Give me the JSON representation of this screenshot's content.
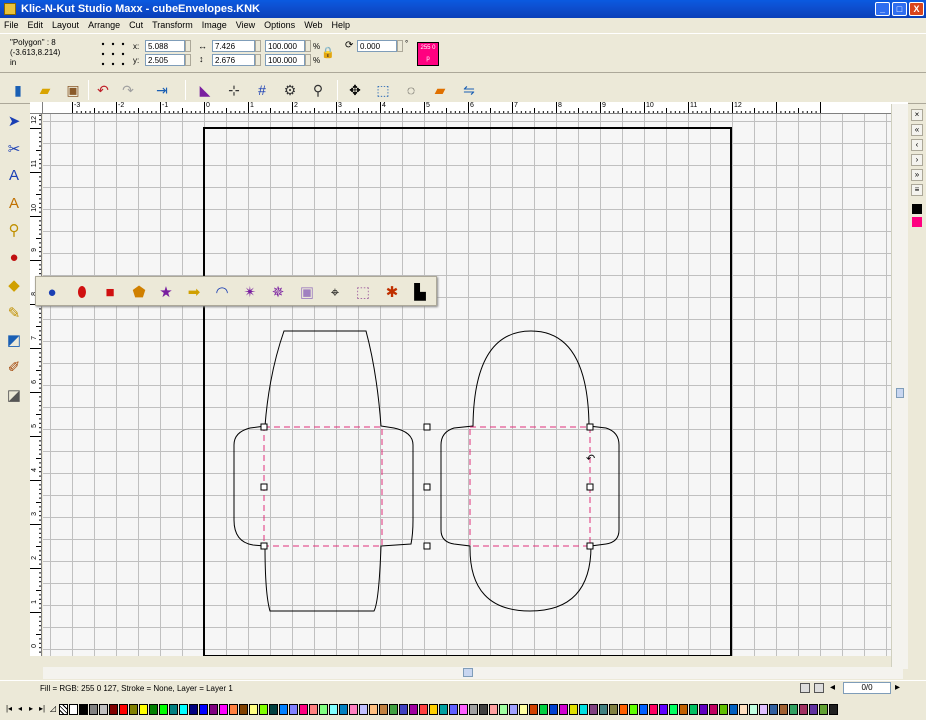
{
  "window": {
    "title": "Klic-N-Kut Studio Maxx - cubeEnvelopes.KNK",
    "buttons": [
      "_",
      "□",
      "X"
    ]
  },
  "menu": [
    "File",
    "Edit",
    "Layout",
    "Arrange",
    "Cut",
    "Transform",
    "Image",
    "View",
    "Options",
    "Web",
    "Help"
  ],
  "properties": {
    "object_name": "\"Polygon\" : 8",
    "position_readout": "(-3.613,8.214)",
    "units": "in",
    "x_label": "x:",
    "x_value": "5.088",
    "y_label": "y:",
    "y_value": "2.505",
    "width_value": "7.426",
    "height_value": "2.676",
    "scale_w": "100.000",
    "scale_h": "100.000",
    "percent_symbol": "%",
    "rotation_value": "0.000",
    "rotation_unit": "°",
    "color_chip_label": "255 0 p",
    "fill_color": "#ff0080"
  },
  "toolbar": {
    "icons": [
      "new-document-icon",
      "open-folder-icon",
      "package-icon",
      "undo-icon",
      "redo-icon",
      "exit-icon",
      "select-mode-icon",
      "node-grid-icon",
      "snap-grid-icon",
      "tool-settings-icon",
      "weld-icon",
      "move-icon",
      "scale-icon",
      "rotate-icon",
      "skew-icon",
      "mirror-icon"
    ]
  },
  "tools": [
    "arrow-pointer-tool",
    "knife-tool",
    "text-tool",
    "text-path-tool",
    "zoom-tool",
    "shapes-tool",
    "image-tool",
    "pencil-tool",
    "eraser-tool",
    "brush-tool",
    "fill-tool"
  ],
  "shape_flyout": [
    "sphere",
    "ellipse",
    "rectangle",
    "pentagon",
    "star",
    "arrow",
    "arc",
    "star-frame",
    "star-frame-alt",
    "image-frame",
    "crosshair",
    "image-resize",
    "clip-art",
    "stamp"
  ],
  "h_ruler_labels": [
    "-3",
    "-2",
    "-1",
    "0",
    "1",
    "2",
    "3",
    "4",
    "5",
    "6",
    "7",
    "8",
    "9",
    "10",
    "11",
    "12"
  ],
  "v_ruler_labels": [
    "12",
    "11",
    "10",
    "9",
    "8",
    "7",
    "6",
    "5",
    "4",
    "3",
    "2",
    "1",
    "0"
  ],
  "status": {
    "text": "Fill = RGB: 255 0 127, Stroke = None, Layer = Layer 1",
    "page": "0/0"
  },
  "palette": [
    "#ffffff",
    "#000000",
    "#808080",
    "#c0c0c0",
    "#800000",
    "#ff0000",
    "#808000",
    "#ffff00",
    "#008000",
    "#00ff00",
    "#008080",
    "#00ffff",
    "#000080",
    "#0000ff",
    "#800080",
    "#ff00ff",
    "#ff8040",
    "#804000",
    "#ffff80",
    "#80ff00",
    "#004040",
    "#0080ff",
    "#8080ff",
    "#ff0080",
    "#ff8080",
    "#80ff80",
    "#80ffff",
    "#0080c0",
    "#ff80c0",
    "#c0c0ff",
    "#ffc080",
    "#c08040",
    "#40a040",
    "#4040c0",
    "#a000a0",
    "#ff4040",
    "#ffd000",
    "#00a0a0",
    "#6060ff",
    "#ff60ff",
    "#a0a0a0",
    "#404040",
    "#ffa0a0",
    "#a0ffa0",
    "#a0a0ff",
    "#ffffa0",
    "#d04000",
    "#00d040",
    "#0040d0",
    "#d000d0",
    "#e0e000",
    "#00e0e0",
    "#804080",
    "#408080",
    "#808040",
    "#ff6000",
    "#60ff00",
    "#0060ff",
    "#ff0060",
    "#6000ff",
    "#00ff60",
    "#c06000",
    "#00c060",
    "#6000c0",
    "#c00060",
    "#60c000",
    "#0060c0",
    "#ffe0c0",
    "#c0ffe0",
    "#e0c0ff",
    "#3060a0",
    "#a06030",
    "#30a060",
    "#a03060",
    "#6030a0",
    "#60a030",
    "#202020"
  ]
}
